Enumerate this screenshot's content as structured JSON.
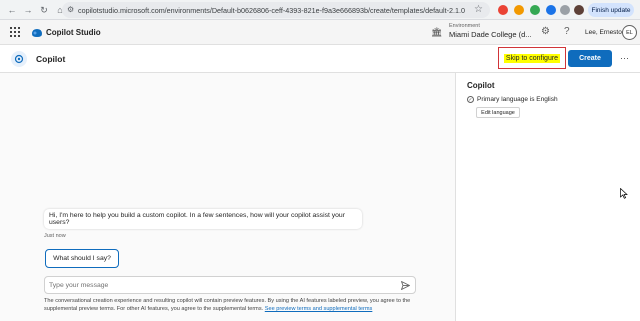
{
  "browser": {
    "url": "copilotstudio.microsoft.com/environments/Default-b0626806-ceff-4393-821e-f9a3e666893b/create/templates/default-2.1.0",
    "finish_update_label": "Finish update",
    "icons": [
      "back-arrow-icon",
      "forward-arrow-icon",
      "reload-icon",
      "home-icon",
      "site-info-icon",
      "star-icon"
    ]
  },
  "app_header": {
    "brand": "Copilot Studio",
    "environment_label": "Environment",
    "environment_value": "Miami Dade College (d...",
    "user_name": "Lee, Ernesto",
    "avatar_initials": "EL"
  },
  "page": {
    "title": "Copilot",
    "skip_label": "Skip to configure",
    "create_label": "Create",
    "more_label": "···"
  },
  "chat": {
    "bot_message": "Hi, I'm here to help you build a custom copilot. In a few sentences, how will your copilot assist your users?",
    "timestamp": "Just now",
    "suggestion": "What should I say?",
    "input_placeholder": "Type your message",
    "disclaimer": "The conversational creation experience and resulting copilot will contain preview features. By using the AI features labeled preview, you agree to the supplemental preview terms. For other AI features, you agree to the supplemental terms.",
    "disclaimer_link": "See preview terms and supplemental terms"
  },
  "side_panel": {
    "title": "Copilot",
    "language_text": "Primary language is English",
    "edit_language_label": "Edit language"
  },
  "colors": {
    "accent": "#0f6cbd",
    "highlight": "#ffff00",
    "annotation_border": "#d13438"
  }
}
